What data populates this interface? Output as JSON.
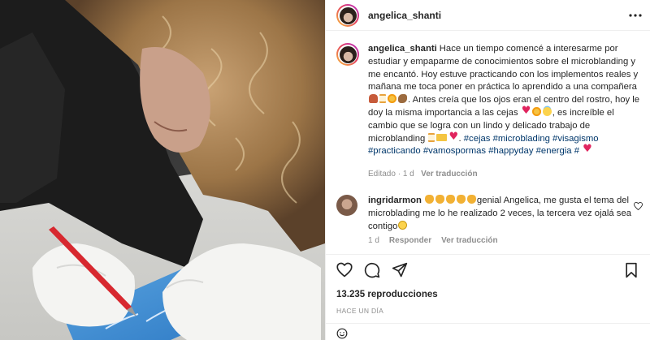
{
  "post": {
    "username": "angelica_shanti",
    "caption": {
      "text_1": "Hace un tiempo comencé a interesarme por estudiar y empaparme de conocimientos sobre el microblanding y me encantó. Hoy estuve practicando con los implementos reales y mañana me toca poner en práctica lo aprendido a una compañera",
      "text_2": ". Antes creía que los ojos eran el centro del rostro, hoy le doy la misma importancia a las cejas",
      "text_3": ", es increíble el cambio que se logra con un lindo y delicado trabajo de microblanding",
      "text_4": ".",
      "hashtags": [
        "#cejas",
        "#microblading",
        "#visagismo",
        "#practicando",
        "#vamospormas",
        "#happyday",
        "#energia",
        "#"
      ]
    },
    "caption_meta": {
      "edited": "Editado",
      "sep": "·",
      "time": "1 d",
      "translate": "Ver traducción"
    },
    "comment": {
      "username": "ingridarmon",
      "text": "genial Angelica, me gusta el tema del microblading me lo he realizado 2 veces, la tercera vez ojalá sea contigo",
      "time": "1 d",
      "reply": "Responder",
      "translate": "Ver traducción"
    },
    "views": "13.235 reproducciones",
    "posted_ago": "HACE UN DÍA"
  },
  "icons": {
    "more": "more-options-icon",
    "like": "heart-icon",
    "comment": "comment-icon",
    "share": "share-icon",
    "save": "bookmark-icon",
    "emoji": "emoji-icon"
  },
  "colors": {
    "link": "#00376b",
    "muted": "#8e8e8e",
    "text": "#262626",
    "story_ring_start": "#f9c13a",
    "story_ring_end": "#b52dd0"
  }
}
